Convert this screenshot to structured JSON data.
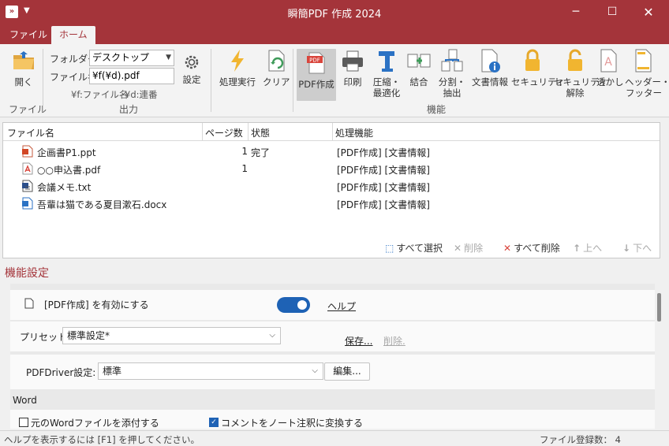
{
  "window": {
    "title": "瞬簡PDF 作成 2024",
    "app_icon": "»",
    "quick_access": "▼"
  },
  "controls": {
    "minimize": "─",
    "maximize": "☐",
    "close": "✕"
  },
  "tabs": {
    "file": "ファイル",
    "home": "ホーム"
  },
  "ribbon": {
    "open": "開く",
    "group_file": "ファイル",
    "folder_label": "フォルダー",
    "folder_value": "デスクトップ",
    "filename_label": "ファイル名",
    "filename_value": "¥f(¥d).pdf",
    "hint_f": "¥f:ファイル名",
    "hint_d": "¥d:連番",
    "settings": "設定",
    "group_output": "出力",
    "run": "処理実行",
    "clear": "クリア",
    "pdf_create": "PDF作成",
    "print": "印刷",
    "compress_1": "圧縮・",
    "compress_2": "最適化",
    "merge": "結合",
    "split_1": "分割・",
    "split_2": "抽出",
    "docinfo": "文書情報",
    "security": "セキュリティ",
    "security_off_1": "セキュリティ",
    "security_off_2": "解除",
    "watermark": "透かし",
    "header_1": "ヘッダー・",
    "header_2": "フッター",
    "group_func": "機能"
  },
  "file_list": {
    "col_name": "ファイル名",
    "col_pages": "ページ数",
    "col_state": "状態",
    "col_func": "処理機能",
    "rows": [
      {
        "name": "企画書P1.ppt",
        "pages": "1",
        "state": "完了",
        "func": "[PDF作成] [文書情報]",
        "type": "ppt"
      },
      {
        "name": "○○申込書.pdf",
        "pages": "1",
        "state": "",
        "func": "[PDF作成] [文書情報]",
        "type": "pdf"
      },
      {
        "name": "会議メモ.txt",
        "pages": "",
        "state": "",
        "func": "[PDF作成] [文書情報]",
        "type": "txt"
      },
      {
        "name": "吾輩は猫である夏目漱石.docx",
        "pages": "",
        "state": "",
        "func": "[PDF作成] [文書情報]",
        "type": "docx"
      }
    ],
    "select_all": "すべて選択",
    "delete": "削除",
    "delete_all": "すべて削除",
    "up": "上へ",
    "down": "下へ"
  },
  "settings": {
    "title": "機能設定",
    "enable_label": "[PDF作成] を有効にする",
    "help": "ヘルプ",
    "preset_label": "プリセット：",
    "preset_value": "標準設定*",
    "save": "保存...",
    "remove": "削除.",
    "driver_label": "PDFDriver設定:",
    "driver_value": "標準",
    "edit": "編集...",
    "section_word": "Word",
    "attach_word": "元のWordファイルを添付する",
    "comments_to_notes": "コメントをノート注釈に変換する",
    "enabled": true,
    "attach_checked": false,
    "comments_checked": true
  },
  "status": {
    "hint": "ヘルプを表示するには [F1] を押してください。",
    "count": "ファイル登録数：  4"
  },
  "colors": {
    "brand": "#a4343a",
    "accent": "#1e62b5"
  }
}
